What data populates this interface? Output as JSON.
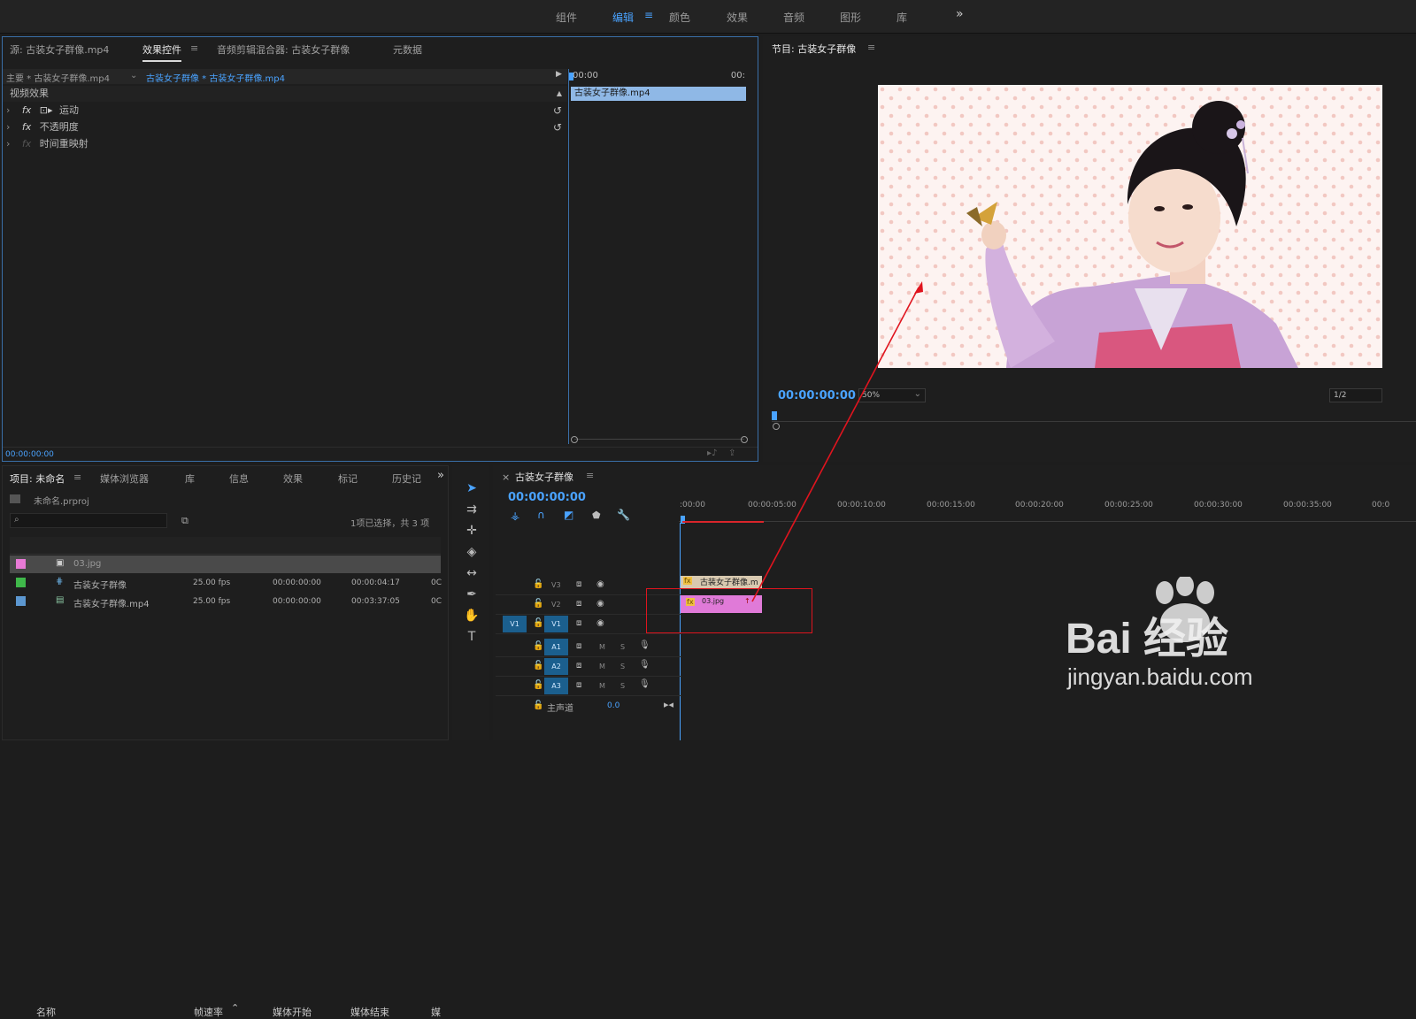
{
  "workspace": {
    "tabs": [
      "组件",
      "编辑",
      "颜色",
      "效果",
      "音频",
      "图形",
      "库"
    ],
    "active_index": 1,
    "more_label": "»"
  },
  "source_panel": {
    "tabs": [
      "源: 古装女子群像.mp4",
      "效果控件",
      "音频剪辑混合器: 古装女子群像",
      "元数据"
    ],
    "active_index": 1,
    "master_label": "主要 * 古装女子群像.mp4",
    "sequence_label": "古装女子群像 * 古装女子群像.mp4",
    "section_label": "视频效果",
    "effects": [
      {
        "label": "运动",
        "fx": "fx",
        "has_reset": true
      },
      {
        "label": "不透明度",
        "fx": "fx",
        "has_reset": true
      },
      {
        "label": "时间重映射",
        "fx": "fx",
        "has_reset": false
      }
    ],
    "mini_timeline": {
      "start": "00:00",
      "end": "00:",
      "clip_label": "古装女子群像.mp4"
    },
    "timecode": "00:00:00:00"
  },
  "program_monitor": {
    "title": "节目: 古装女子群像",
    "timecode": "00:00:00:00",
    "zoom": "50%",
    "resolution": "1/2",
    "controls": [
      "marker-icon",
      "in-point-icon",
      "out-point-icon",
      "go-to-in-icon",
      "step-back-icon",
      "play-icon",
      "step-forward-icon",
      "go-to-out-icon",
      "lift-icon",
      "extract-icon",
      "camera-icon"
    ]
  },
  "project_panel": {
    "tabs": [
      "项目: 未命名",
      "媒体浏览器",
      "库",
      "信息",
      "效果",
      "标记",
      "历史记"
    ],
    "active_index": 0,
    "file_name": "未命名.prproj",
    "selection_info": "1项已选择，共 3 项",
    "columns": [
      "名称",
      "帧速率",
      "媒体开始",
      "媒体结束",
      "媒"
    ],
    "items": [
      {
        "name": "03.jpg",
        "fps": "",
        "start": "",
        "end": "",
        "extra": "",
        "color": "#e87ad6",
        "selected": true
      },
      {
        "name": "古装女子群像",
        "fps": "25.00 fps",
        "start": "00:00:00:00",
        "end": "00:00:04:17",
        "extra": "0C",
        "color": "#3fb84a",
        "selected": false
      },
      {
        "name": "古装女子群像.mp4",
        "fps": "25.00 fps",
        "start": "00:00:00:00",
        "end": "00:03:37:05",
        "extra": "0C",
        "color": "#5c97d0",
        "selected": false
      }
    ]
  },
  "timeline": {
    "sequence_title": "古装女子群像",
    "timecode": "00:00:00:00",
    "ruler": [
      ":00:00",
      "00:00:05:00",
      "00:00:10:00",
      "00:00:15:00",
      "00:00:20:00",
      "00:00:25:00",
      "00:00:30:00",
      "00:00:35:00",
      "00:0"
    ],
    "video_tracks": [
      "V3",
      "V2",
      "V1"
    ],
    "audio_tracks": [
      "A1",
      "A2",
      "A3"
    ],
    "source_patch": "V1",
    "master_label": "主声道",
    "master_value": "0.0",
    "clips": [
      {
        "label": "古装女子群像.m",
        "track": "V3",
        "color": "#d8c9b0"
      },
      {
        "label": "03.jpg",
        "track": "V2",
        "color": "#e07ad8"
      }
    ]
  },
  "watermark": {
    "brand": "Bai 经验",
    "url": "jingyan.baidu.com"
  },
  "accent": "#4aa3ff",
  "annotation_color": "#e0141e"
}
